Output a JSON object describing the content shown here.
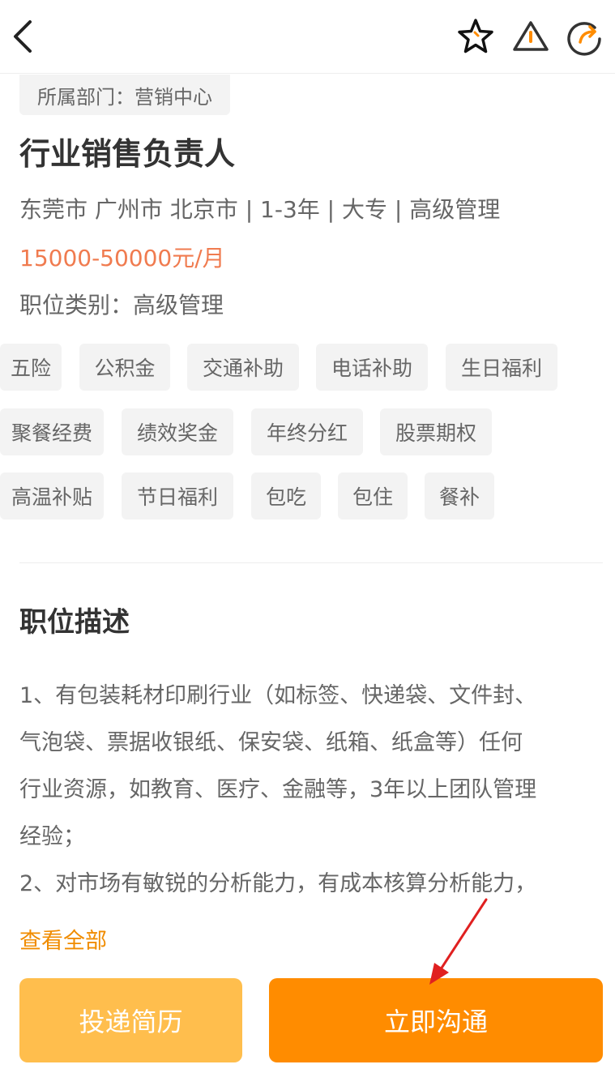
{
  "header": {
    "back_icon": "chevron-left-icon",
    "star_icon": "star-icon",
    "warn_icon": "warning-icon",
    "share_icon": "share-icon",
    "accent": "#ff8c00"
  },
  "job": {
    "department": "所属部门：营销中心",
    "title": "行业销售负责人",
    "meta": "东莞市 广州市 北京市 | 1-3年 | 大专 | 高级管理",
    "salary": "15000-50000元/月",
    "category": "职位类别：高级管理",
    "salary_color": "#f07b4f"
  },
  "benefits": [
    "五险",
    "公积金",
    "交通补助",
    "电话补助",
    "生日福利",
    "聚餐经费",
    "绩效奖金",
    "年终分红",
    "股票期权",
    "高温补贴",
    "节日福利",
    "包吃",
    "包住",
    "餐补"
  ],
  "description": {
    "title": "职位描述",
    "lines": [
      "1、有包装耗材印刷行业（如标签、快递袋、文件封、",
      "气泡袋、票据收银纸、保安袋、纸箱、纸盒等）任何",
      "行业资源，如教育、医疗、金融等，3年以上团队管理",
      "经验；",
      "2、对市场有敏锐的分析能力，有成本核算分析能力，"
    ],
    "view_all": "查看全部"
  },
  "actions": {
    "apply": "投递简历",
    "chat": "立即沟通",
    "apply_color": "#ffbe4d",
    "chat_color": "#ff8c00"
  }
}
